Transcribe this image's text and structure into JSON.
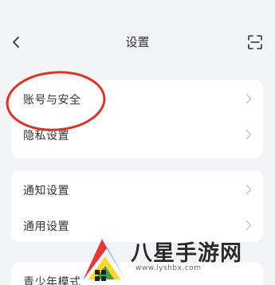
{
  "header": {
    "title": "设置"
  },
  "groups": [
    {
      "items": [
        {
          "label": "账号与安全"
        },
        {
          "label": "隐私设置"
        }
      ]
    },
    {
      "items": [
        {
          "label": "通知设置"
        },
        {
          "label": "通用设置"
        }
      ]
    },
    {
      "items": [
        {
          "label": "青少年模式"
        }
      ]
    }
  ],
  "annotation": {
    "circle_color": "#d9362b"
  },
  "watermark": {
    "text": "八星手游网",
    "url": "www.lyshbx.com"
  },
  "icons": {
    "back": "chevron-left-icon",
    "scan": "scan-icon",
    "row_arrow": "chevron-right-icon"
  }
}
